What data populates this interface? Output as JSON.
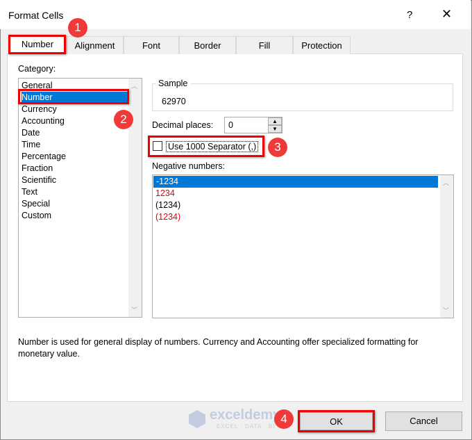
{
  "window": {
    "title": "Format Cells",
    "help": "?",
    "close": "✕"
  },
  "tabs": [
    {
      "label": "Number"
    },
    {
      "label": "Alignment"
    },
    {
      "label": "Font"
    },
    {
      "label": "Border"
    },
    {
      "label": "Fill"
    },
    {
      "label": "Protection"
    }
  ],
  "category": {
    "label": "Category:",
    "items": [
      "General",
      "Number",
      "Currency",
      "Accounting",
      "Date",
      "Time",
      "Percentage",
      "Fraction",
      "Scientific",
      "Text",
      "Special",
      "Custom"
    ],
    "selected": "Number"
  },
  "sample": {
    "label": "Sample",
    "value": "62970"
  },
  "decimal": {
    "label": "Decimal places:",
    "value": "0"
  },
  "separator": {
    "label": "Use 1000 Separator (,)",
    "checked": false
  },
  "negative": {
    "label": "Negative numbers:",
    "items": [
      {
        "text": "-1234",
        "color": "#ffffff"
      },
      {
        "text": "1234",
        "color": "#e00000"
      },
      {
        "text": "(1234)",
        "color": "#000000"
      },
      {
        "text": "(1234)",
        "color": "#e00000"
      }
    ]
  },
  "description": {
    "line1": "Number is used for general display of numbers.  Currency and Accounting offer specialized formatting for",
    "line2": "monetary value."
  },
  "buttons": {
    "ok": "OK",
    "cancel": "Cancel"
  },
  "badges": [
    "1",
    "2",
    "3",
    "4"
  ],
  "watermark": {
    "name": "exceldemy",
    "tagline": "EXCEL - DATA - BI"
  },
  "colors": {
    "highlight": "#e00000",
    "selection": "#0078d7"
  }
}
